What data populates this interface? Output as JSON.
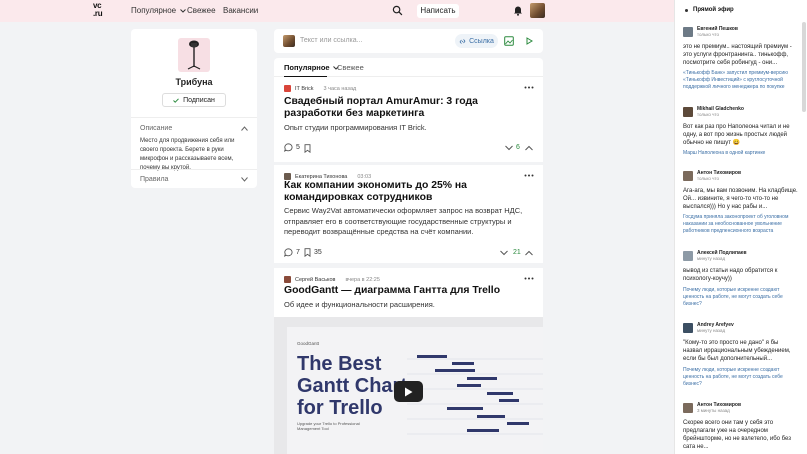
{
  "header": {
    "logo_top": "vc",
    "logo_bottom": ".ru",
    "nav_popular": "Популярное",
    "nav_fresh": "Свежее",
    "nav_jobs": "Вакансии",
    "write_label": "Написать"
  },
  "sidebar": {
    "name": "Трибуна",
    "subscribe_label": "Подписан",
    "description_title": "Описание",
    "description": "Место для продвижения себя или своего проекта. Берете в руки микрофон и рассказываете всем, почему вы крутой.",
    "rules_title": "Правила"
  },
  "composer": {
    "placeholder": "Текст или ссылка...",
    "link_label": "Ссылка"
  },
  "feed_tabs": [
    "Популярное",
    "Свежее"
  ],
  "posts": [
    {
      "author": "IT Brick",
      "time": "3 часа назад",
      "title": "Свадебный портал AmurAmur: 3 года разработки без маркетинга",
      "subtitle": "Опыт студии программирования IT Brick.",
      "comments": "5",
      "votes": "6"
    },
    {
      "author": "Екатерина Тихонова",
      "time": "03:03",
      "title": "Как компании экономить до 25% на командировках сотрудников",
      "subtitle": "Сервис Way2Vat автоматически оформляет запрос на возврат НДС, отправляет его в соответствующие государственные структуры и переводит возвращённые средства на счёт компании.",
      "comments": "7",
      "bookmarks": "35",
      "votes": "21"
    },
    {
      "author": "Сергей Васьков",
      "time": "вчера в 22:25",
      "title": "GoodGantt — диаграмма Гантта для Trello",
      "subtitle": "Об идее и функциональности расширения.",
      "video": {
        "brand": "GoodGantt",
        "title": "The Best Gantt Chart for Trello",
        "tagline": "Upgrade your Trello to Professional Management Tool"
      }
    }
  ],
  "live": {
    "title": "Прямой эфир",
    "comments": [
      {
        "name": "Евгений Пешков",
        "time": "только что",
        "text": "это не премиум.. настоящий премиум - это услуги фронтранинга.. тинькофф, посмотрите себя робингуд - они...",
        "link": "«Тинькофф Банк» запустил премиум-версию «Тинькофф Инвестиций» с круглосуточной поддержкой личного менеджера по покупке"
      },
      {
        "name": "Mikhail Gladchenko",
        "time": "только что",
        "text": "Вот как раз про Наполеона читал и не одну, а вот про жизнь простых людей обычно не пишут 😀",
        "link": "Марш Наполеона в одной картинке"
      },
      {
        "name": "Антон Тихомиров",
        "time": "только что",
        "text": "Ага-ага, мы вам позвоним. На кладбище. Ой... извините, я чего-то что-то не выспался))) Но у нас рабы и...",
        "link": "Госдума приняла законопроект об уголовном наказании за необоснованное увольнение работников предпенсионного возраста"
      },
      {
        "name": "Алексей Подлипаев",
        "time": "минуту назад",
        "text": "вывод из статьи надо обратится к психологу-коучу))",
        "link": "Почему люди, которые искренне создают ценность на работе, не могут создать себе бизнес?"
      },
      {
        "name": "Andrey Arefyev",
        "time": "минуту назад",
        "text": "\"Кому-то это просто не дано\" я бы назвал иррациональным убеждением, если бы был дополнительный...",
        "link": "Почему люди, которые искренне создают ценность на работе, не могут создать себе бизнес?"
      },
      {
        "name": "Антон Тихомиров",
        "time": "3 минуты назад",
        "text": "Скорее всего они там у себя это предлагали уже на очередном брейншторме, но не взлетело, ибо без сата не...",
        "link": ""
      }
    ]
  }
}
